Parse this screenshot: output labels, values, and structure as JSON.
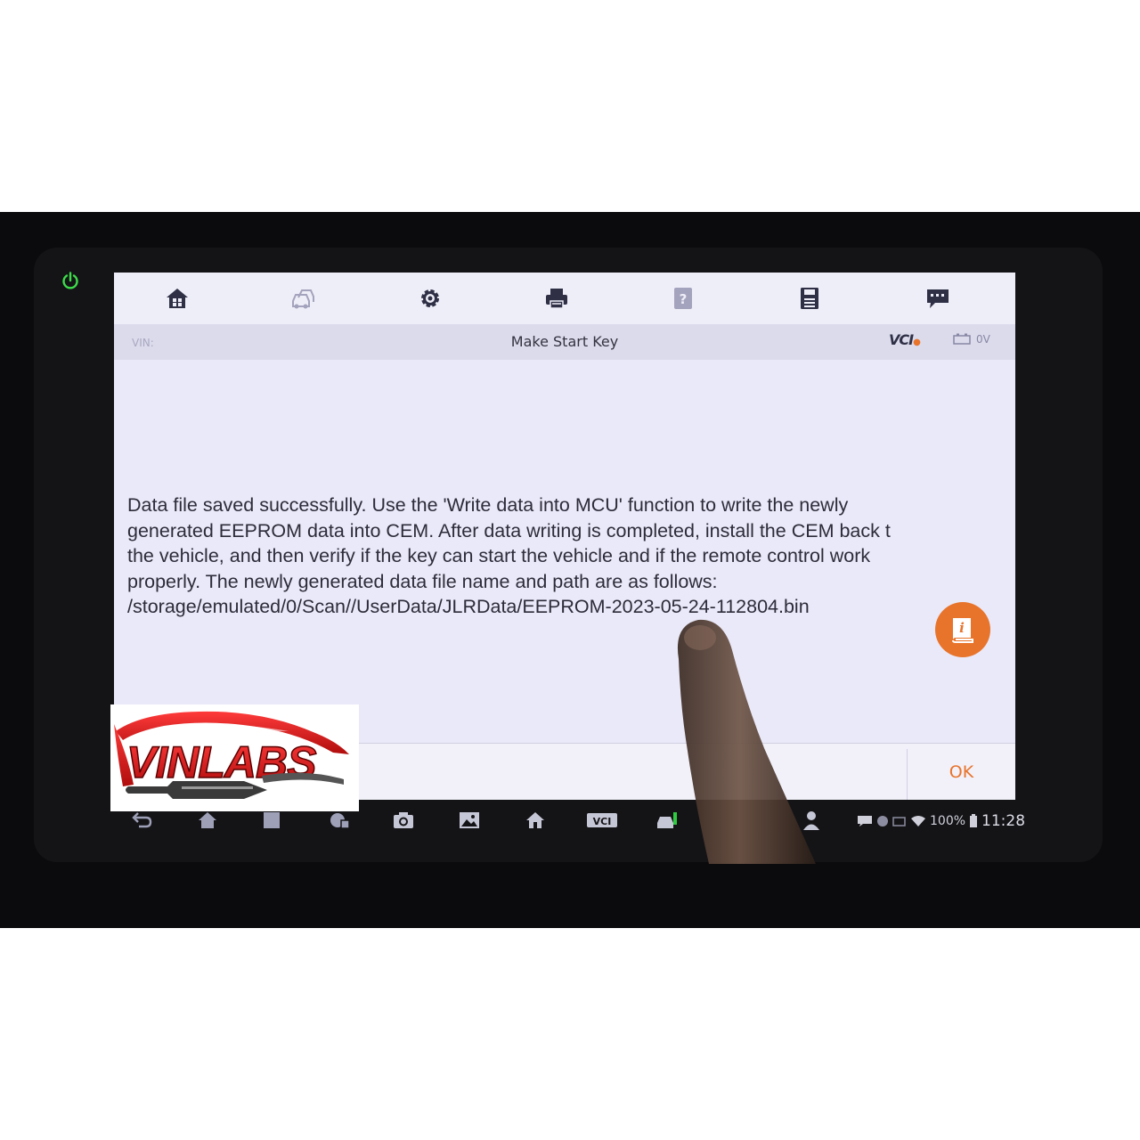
{
  "toolbar": {
    "icons": [
      "home-icon",
      "vehicle-icon",
      "settings-icon",
      "print-icon",
      "help-icon",
      "save-icon",
      "feedback-icon"
    ]
  },
  "titlebar": {
    "vin_label": "VIN:",
    "title": "Make Start Key",
    "vci_label": "VCI",
    "voltage": "0V"
  },
  "message": {
    "lines": [
      "Data file saved successfully. Use the 'Write data into MCU' function to write the newly",
      "generated EEPROM data into CEM. After data writing is completed, install the CEM back t",
      "the vehicle, and then verify if the key can start the vehicle and if the remote control work",
      "properly. The newly generated data file name and path are as follows:",
      "/storage/emulated/0/Scan//UserData/JLRData/EEPROM-2023-05-24-112804.bin"
    ]
  },
  "footer": {
    "ok_label": "OK"
  },
  "statusbar": {
    "battery_percent": "100%",
    "time": "11:28"
  },
  "navbar": {
    "vci_label": "VCI"
  },
  "watermark": {
    "text": "VINLABS"
  },
  "colors": {
    "accent": "#e8742b",
    "screen_bg": "#eae9f9",
    "power_led": "#2ecc40"
  }
}
